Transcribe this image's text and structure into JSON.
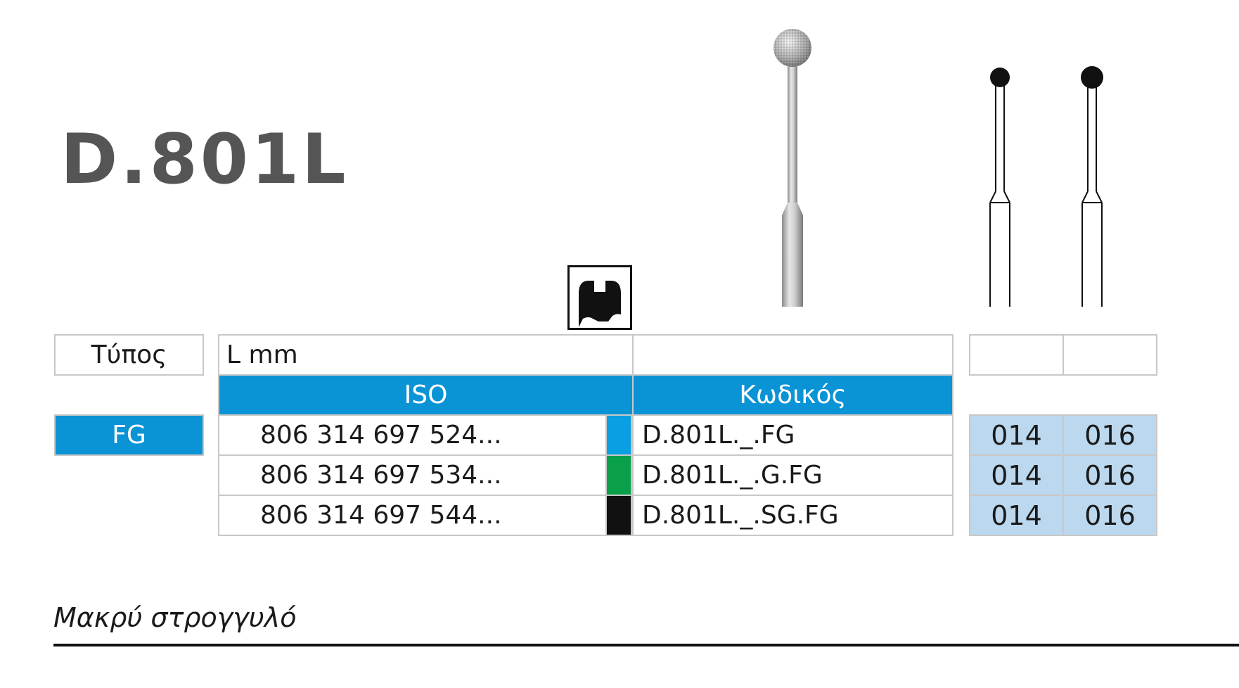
{
  "product": {
    "name": "D.801L",
    "description": "Μακρύ στρογγυλό"
  },
  "table": {
    "type_label": "Τύπος",
    "length_label": "L mm",
    "iso_header": "ISO",
    "code_header": "Κωδικός",
    "shank": "FG",
    "rows": [
      {
        "iso": "806 314 697 524...",
        "grit_color": "#0a9ee3",
        "code": "D.801L._.FG",
        "sizes": [
          "014",
          "016"
        ]
      },
      {
        "iso": "806 314 697 534...",
        "grit_color": "#0aa04a",
        "code": "D.801L._.G.FG",
        "sizes": [
          "014",
          "016"
        ]
      },
      {
        "iso": "806 314 697 544...",
        "grit_color": "#111111",
        "code": "D.801L._.SG.FG",
        "sizes": [
          "014",
          "016"
        ]
      }
    ]
  },
  "colors": {
    "header_blue": "#0a93d5",
    "size_bg": "#bcd8ef",
    "title_gray": "#555555"
  },
  "icons": [
    "application-icon",
    "bur-photo",
    "bur-diagram-014",
    "bur-diagram-016"
  ]
}
